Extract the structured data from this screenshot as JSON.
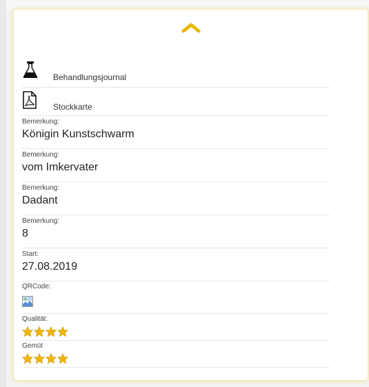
{
  "colors": {
    "accent": "#e6b800",
    "star": "#f2b600",
    "card_glow": "#f4ebc4"
  },
  "collapse_button": {
    "icon": "chevron-up-icon"
  },
  "links": [
    {
      "label": "Behandlungsjournal",
      "icon": "flask-icon"
    },
    {
      "label": "Stockkarte",
      "icon": "pdf-file-icon"
    }
  ],
  "fields": [
    {
      "label": "Bemerkung:",
      "value": "Königin Kunstschwarm"
    },
    {
      "label": "Bemerkung:",
      "value": "vom Imkervater"
    },
    {
      "label": "Bemerkung:",
      "value": "Dadant"
    },
    {
      "label": "Bemerkung:",
      "value": "8"
    },
    {
      "label": "Start:",
      "value": "27.08.2019"
    }
  ],
  "qrcode": {
    "label": "QRCode:",
    "icon": "broken-image-icon"
  },
  "ratings": [
    {
      "label": "Qualität:",
      "stars": 4
    },
    {
      "label": "Gemüt",
      "stars": 4
    }
  ]
}
